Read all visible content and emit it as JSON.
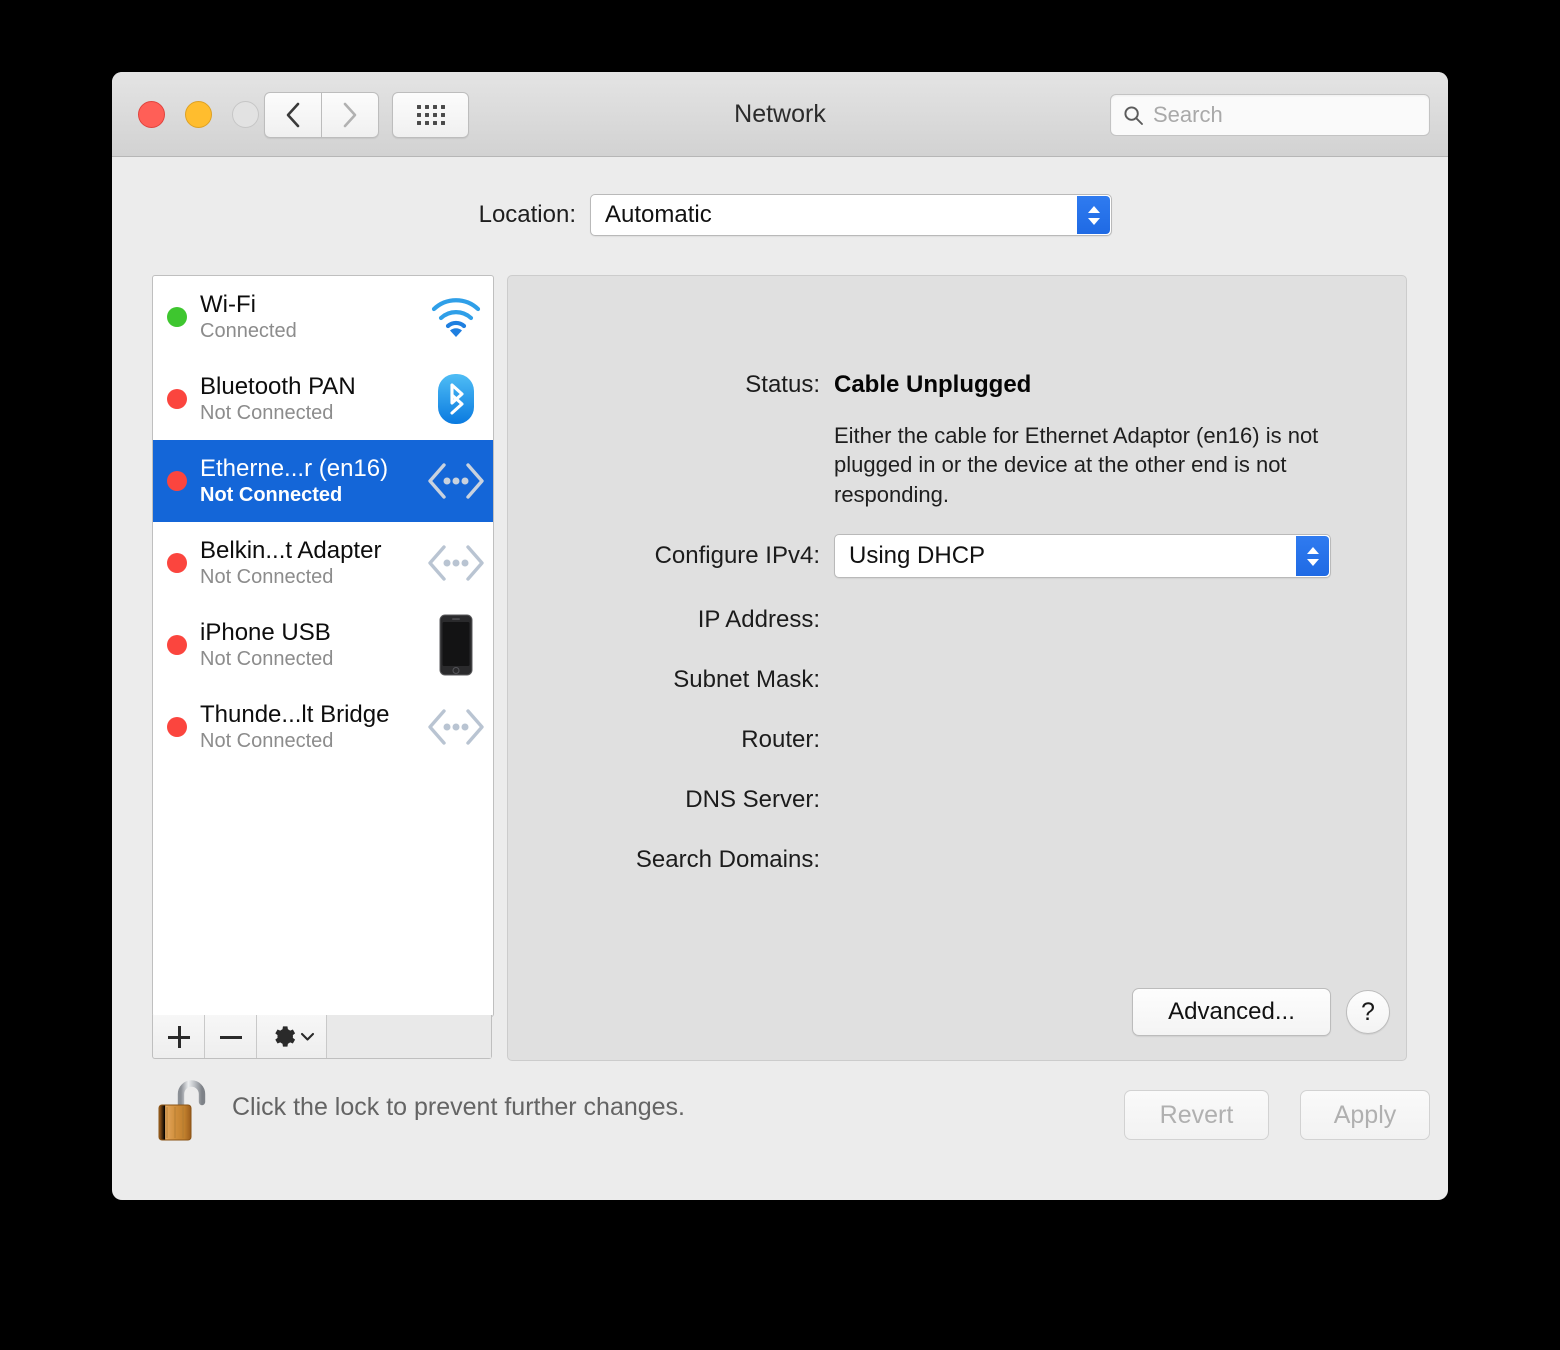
{
  "window": {
    "title": "Network",
    "traffic_lights": [
      "close-button",
      "minimize-button",
      "zoom-button"
    ]
  },
  "toolbar": {
    "back_icon": "chevron-left-icon",
    "forward_icon": "chevron-right-icon",
    "show_all_icon": "grid-icon",
    "search": {
      "placeholder": "Search",
      "icon": "search-icon",
      "value": ""
    }
  },
  "location": {
    "label": "Location:",
    "value": "Automatic"
  },
  "interfaces": [
    {
      "name": "Wi-Fi",
      "status": "Connected",
      "dot": "green",
      "icon": "wifi-icon",
      "selected": false
    },
    {
      "name": "Bluetooth PAN",
      "status": "Not Connected",
      "dot": "red",
      "icon": "bluetooth-icon",
      "selected": false
    },
    {
      "name": "Etherne...r (en16)",
      "status": "Not Connected",
      "dot": "red",
      "icon": "ethernet-icon",
      "selected": true
    },
    {
      "name": "Belkin...t Adapter",
      "status": "Not Connected",
      "dot": "red",
      "icon": "ethernet-icon",
      "selected": false
    },
    {
      "name": "iPhone USB",
      "status": "Not Connected",
      "dot": "red",
      "icon": "iphone-icon",
      "selected": false
    },
    {
      "name": "Thunde...lt Bridge",
      "status": "Not Connected",
      "dot": "red",
      "icon": "ethernet-icon",
      "selected": false
    }
  ],
  "list_toolbar": {
    "add_label": "+",
    "remove_label": "−",
    "action_icon": "gear-icon",
    "action_chevron": "chevron-down-icon"
  },
  "detail": {
    "status_label": "Status:",
    "status_value": "Cable Unplugged",
    "status_description": "Either the cable for Ethernet Adaptor (en16) is not plugged in or the device at the other end is not responding.",
    "configure_ipv4_label": "Configure IPv4:",
    "configure_ipv4_value": "Using DHCP",
    "fields": [
      {
        "label": "IP Address:",
        "value": ""
      },
      {
        "label": "Subnet Mask:",
        "value": ""
      },
      {
        "label": "Router:",
        "value": ""
      },
      {
        "label": "DNS Server:",
        "value": ""
      },
      {
        "label": "Search Domains:",
        "value": ""
      }
    ],
    "advanced_label": "Advanced...",
    "help_label": "?"
  },
  "footer": {
    "lock_icon": "unlocked-padlock-icon",
    "lock_text": "Click the lock to prevent further changes.",
    "revert_label": "Revert",
    "apply_label": "Apply"
  },
  "colors": {
    "accent_blue": "#1466d8",
    "stepper_blue": "#2f7bf0",
    "status_connected": "#3ec62f",
    "status_disconnected": "#fb453e",
    "window_bg": "#ececec",
    "panel_bg": "#e0e0e0"
  }
}
